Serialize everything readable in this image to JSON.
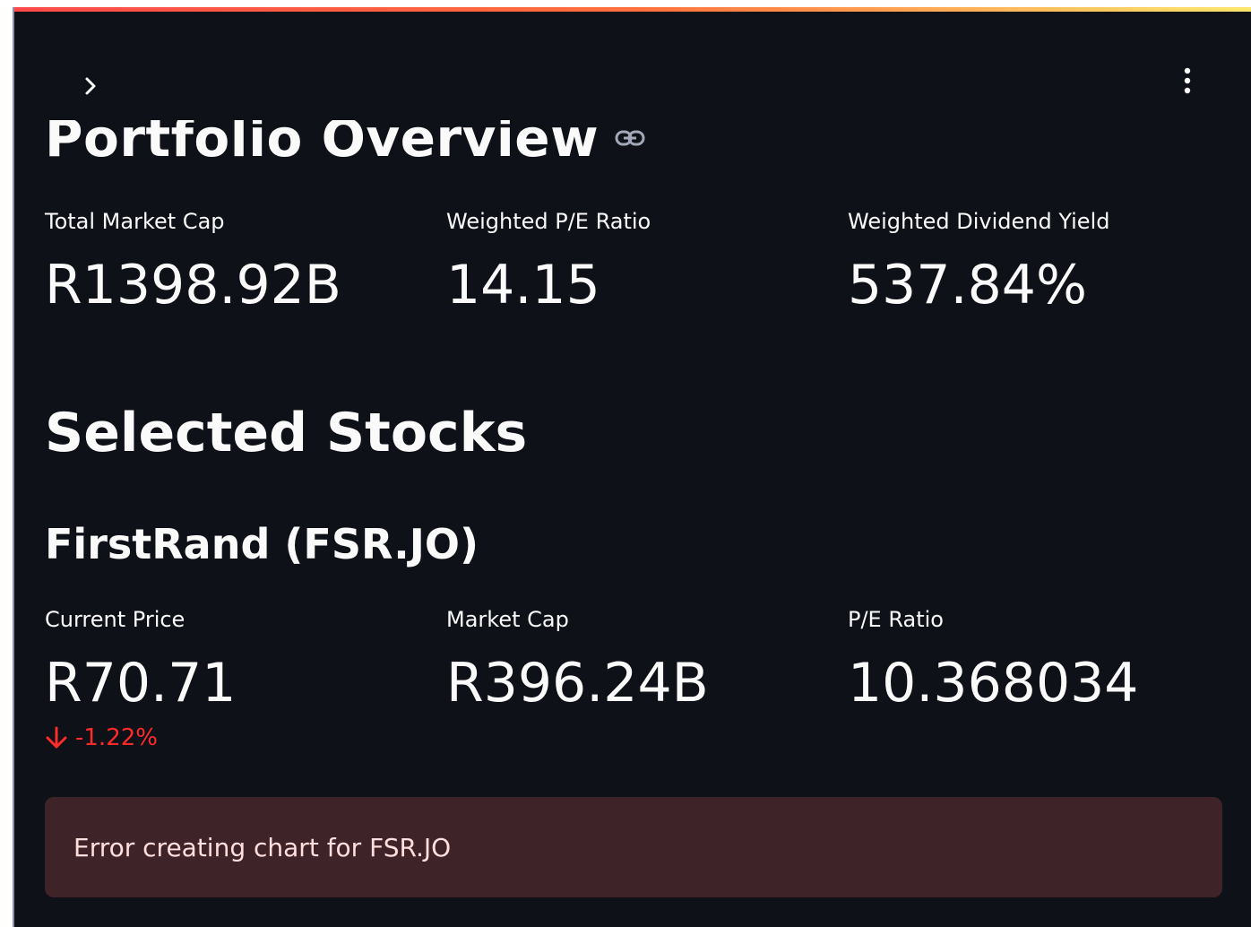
{
  "header": {
    "sidebar_toggle_icon": "chevron-right-icon",
    "menu_icon": "vertical-ellipsis-icon",
    "decoration_colors": [
      "#ff4b4b",
      "#ff6f3c",
      "#ffe66d"
    ]
  },
  "page": {
    "title": "Portfolio Overview",
    "title_anchor_icon": "link-icon"
  },
  "portfolio_metrics": [
    {
      "label": "Total Market Cap",
      "value": "R1398.92B"
    },
    {
      "label": "Weighted P/E Ratio",
      "value": "14.15"
    },
    {
      "label": "Weighted Dividend Yield",
      "value": "537.84%"
    }
  ],
  "selected_stocks": {
    "heading": "Selected Stocks",
    "stocks": [
      {
        "name": "FirstRand (FSR.JO)",
        "metrics": [
          {
            "label": "Current Price",
            "value": "R70.71",
            "delta": "-1.22%",
            "delta_icon": "arrow-down-icon",
            "delta_color": "#ff2b2b"
          },
          {
            "label": "Market Cap",
            "value": "R396.24B"
          },
          {
            "label": "P/E Ratio",
            "value": "10.368034"
          }
        ],
        "error": "Error creating chart for FSR.JO"
      }
    ]
  },
  "colors": {
    "background": "#0e1117",
    "text": "#fafafa",
    "error_background": "#3e2328",
    "error_text": "#ffdede",
    "negative": "#ff2b2b"
  }
}
